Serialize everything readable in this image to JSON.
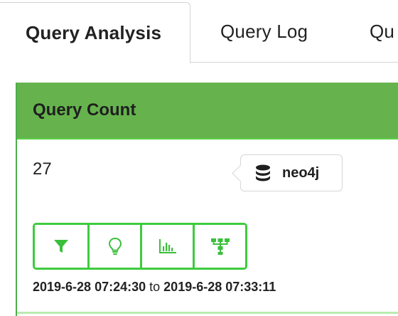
{
  "tabs": [
    {
      "label": "Query Analysis",
      "active": true
    },
    {
      "label": "Query Log",
      "active": false
    },
    {
      "label": "Qu",
      "active": false
    }
  ],
  "card": {
    "title": "Query Count",
    "count": "27",
    "header_color": "#66b34e",
    "accent_color": "#3ecb3e"
  },
  "database": {
    "icon": "database-icon",
    "name": "neo4j"
  },
  "toolbar": {
    "buttons": [
      {
        "icon": "filter-icon"
      },
      {
        "icon": "lightbulb-icon"
      },
      {
        "icon": "bar-chart-icon"
      },
      {
        "icon": "hierarchy-icon"
      }
    ]
  },
  "time_range": {
    "start": "2019-6-28 07:24:30",
    "separator": "to",
    "end": "2019-6-28 07:33:11"
  }
}
